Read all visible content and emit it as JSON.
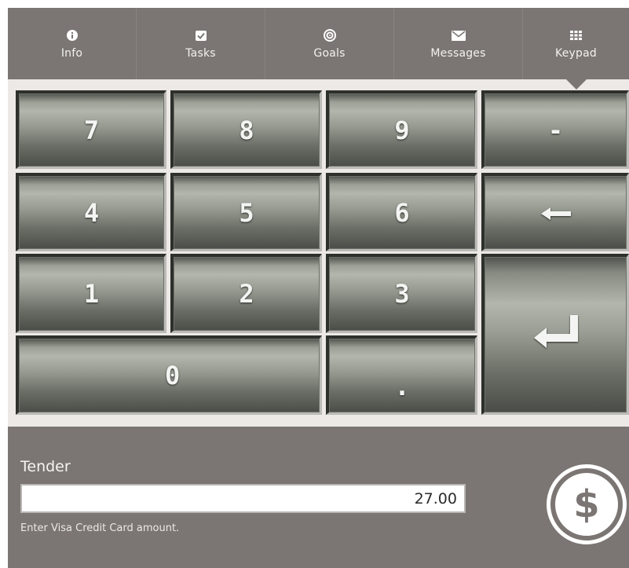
{
  "nav": {
    "items": [
      {
        "label": "Info",
        "icon": "info-icon"
      },
      {
        "label": "Tasks",
        "icon": "checkbox-icon"
      },
      {
        "label": "Goals",
        "icon": "target-icon"
      },
      {
        "label": "Messages",
        "icon": "envelope-icon"
      },
      {
        "label": "Keypad",
        "icon": "keypad-grid-icon",
        "active": true
      }
    ]
  },
  "keypad": {
    "k7": "7",
    "k8": "8",
    "k9": "9",
    "minus": "-",
    "k4": "4",
    "k5": "5",
    "k6": "6",
    "backspace_icon": "left-arrow-icon",
    "k1": "1",
    "k2": "2",
    "k3": "3",
    "enter_icon": "enter-return-icon",
    "k0": "0",
    "decimal": "."
  },
  "tender": {
    "label": "Tender",
    "amount": "27.00",
    "hint": "Enter Visa Credit Card amount.",
    "pay_symbol": "$"
  },
  "colors": {
    "panel": "#7b7673",
    "background": "#ece9e6",
    "key_dark": "#4a4d47",
    "key_light": "#b2b6ac",
    "text_light": "#f6f4f2"
  }
}
